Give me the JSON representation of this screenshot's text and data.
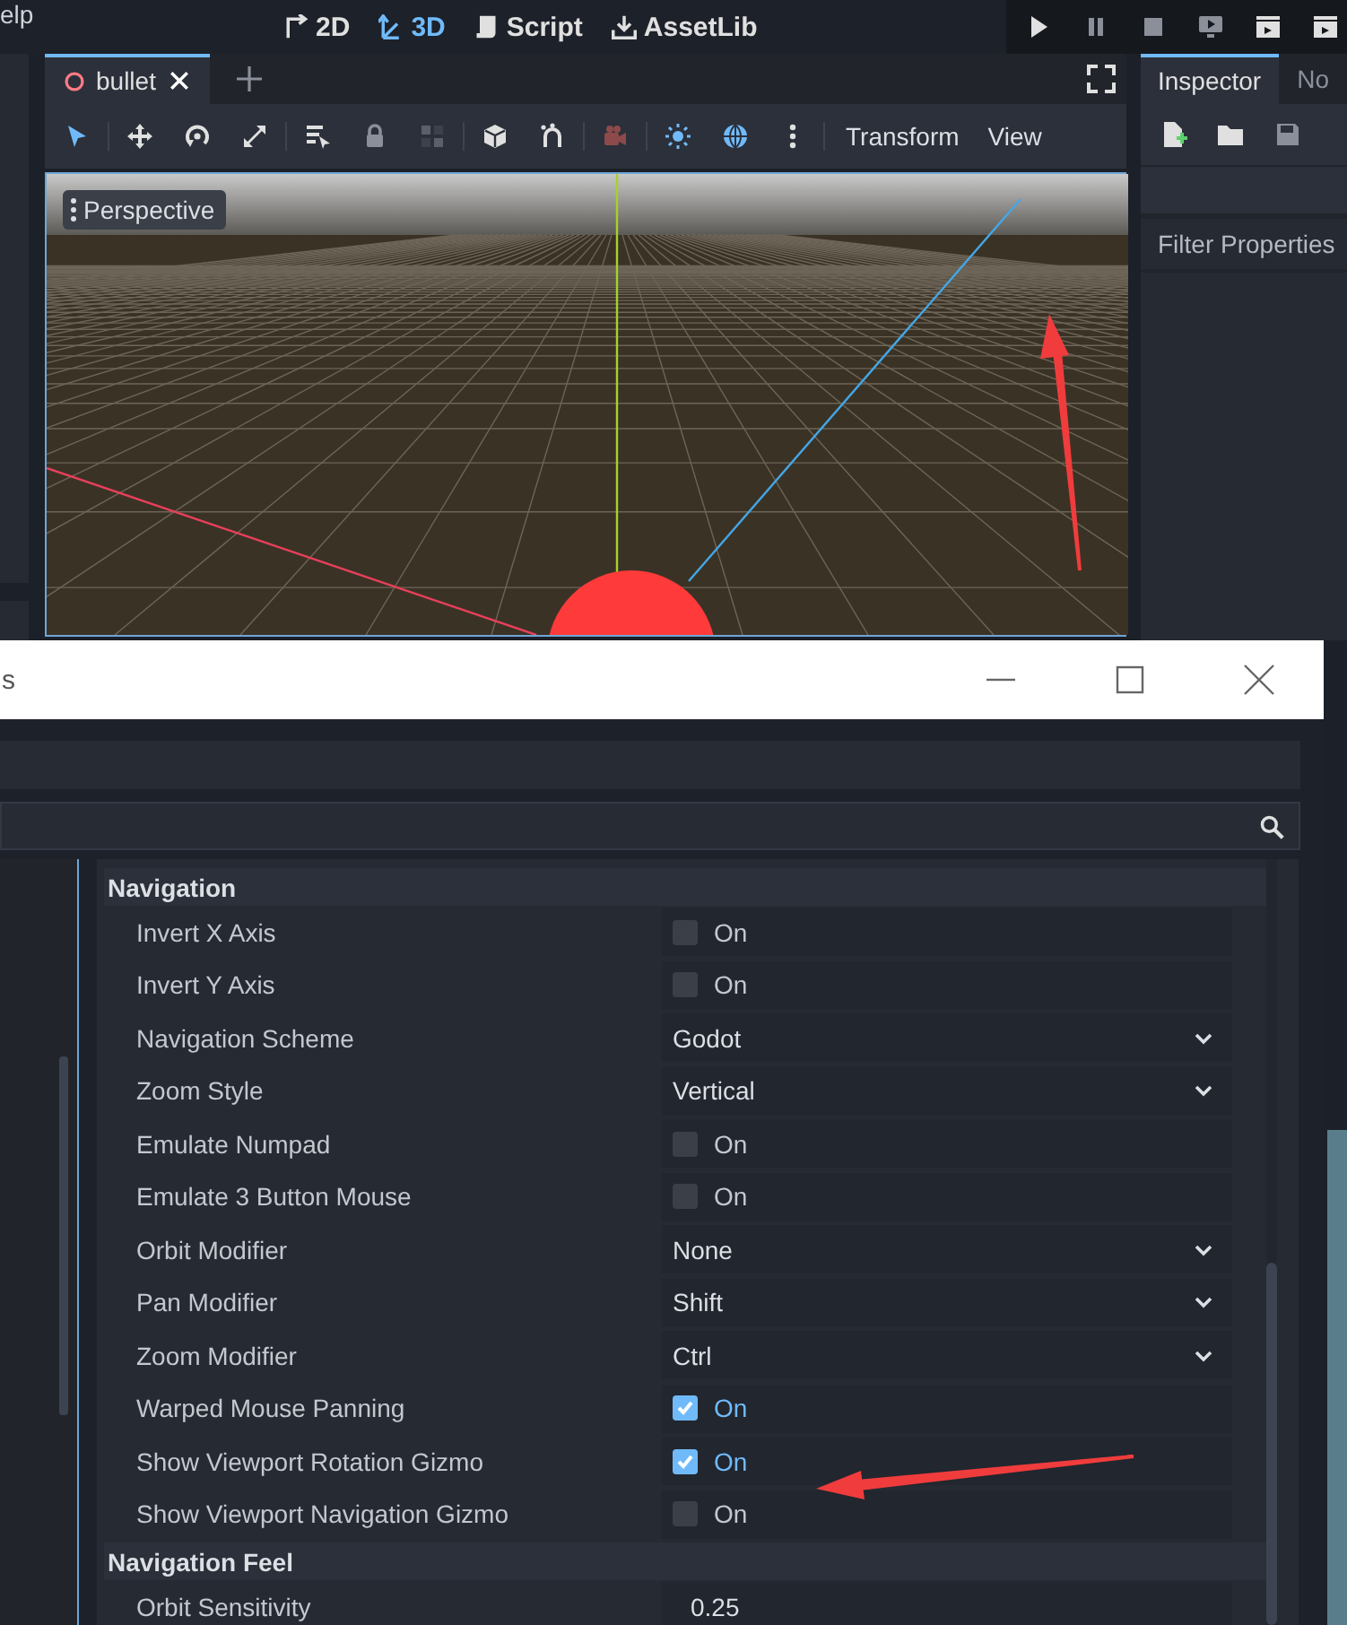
{
  "menu_bar": {
    "menu_fragment": "elp"
  },
  "workspaces": [
    {
      "label": "2D",
      "kind": "planar",
      "selected": false
    },
    {
      "label": "3D",
      "kind": "spatial",
      "selected": true
    },
    {
      "label": "Script",
      "kind": "script",
      "selected": false
    },
    {
      "label": "AssetLib",
      "kind": "assetlib",
      "selected": false
    }
  ],
  "scene_tabs": [
    {
      "label": "bullet",
      "selected": true
    }
  ],
  "viewport_menus": [
    "Transform",
    "View"
  ],
  "viewport": {
    "view_label": "Perspective"
  },
  "inspector_dock": {
    "tabs": [
      {
        "label": "Inspector",
        "selected": true
      },
      {
        "label": "No",
        "selected": false
      }
    ],
    "filter": {
      "placeholder": "Filter Properties"
    }
  },
  "dialog": {
    "title": "s",
    "sections": [
      {
        "title": "Navigation",
        "rows": [
          {
            "label": "Invert X Axis",
            "kind": "check",
            "checked": false,
            "value": "On"
          },
          {
            "label": "Invert Y Axis",
            "kind": "check",
            "checked": false,
            "value": "On"
          },
          {
            "label": "Navigation Scheme",
            "kind": "select",
            "value": "Godot"
          },
          {
            "label": "Zoom Style",
            "kind": "select",
            "value": "Vertical"
          },
          {
            "label": "Emulate Numpad",
            "kind": "check",
            "checked": false,
            "value": "On"
          },
          {
            "label": "Emulate 3 Button Mouse",
            "kind": "check",
            "checked": false,
            "value": "On"
          },
          {
            "label": "Orbit Modifier",
            "kind": "select",
            "value": "None"
          },
          {
            "label": "Pan Modifier",
            "kind": "select",
            "value": "Shift"
          },
          {
            "label": "Zoom Modifier",
            "kind": "select",
            "value": "Ctrl"
          },
          {
            "label": "Warped Mouse Panning",
            "kind": "check",
            "checked": true,
            "value": "On"
          },
          {
            "label": "Show Viewport Rotation Gizmo",
            "kind": "check",
            "checked": true,
            "value": "On"
          },
          {
            "label": "Show Viewport Navigation Gizmo",
            "kind": "check",
            "checked": false,
            "value": "On"
          }
        ]
      },
      {
        "title": "Navigation Feel",
        "rows": [
          {
            "label": "Orbit Sensitivity",
            "kind": "number",
            "value": "0.25"
          }
        ]
      }
    ]
  }
}
